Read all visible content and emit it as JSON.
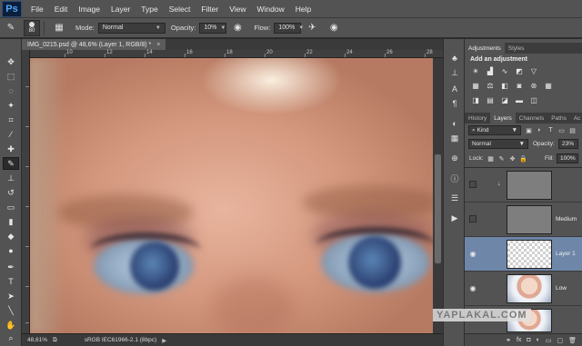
{
  "app": {
    "logo": "Ps"
  },
  "menu": [
    "File",
    "Edit",
    "Image",
    "Layer",
    "Type",
    "Select",
    "Filter",
    "View",
    "Window",
    "Help"
  ],
  "options": {
    "brush_size": "80",
    "mode_label": "Mode:",
    "mode_value": "Normal",
    "opacity_label": "Opacity:",
    "opacity_value": "10%",
    "flow_label": "Flow:",
    "flow_value": "100%"
  },
  "document": {
    "tab_title": "IMG_0215.psd @ 48,6% (Layer 1, RGB/8) *",
    "tab_close": "×",
    "ruler_numbers": [
      "10",
      "12",
      "14",
      "16",
      "18",
      "20",
      "22",
      "24",
      "26",
      "28"
    ],
    "zoom": "48,61%",
    "color_profile": "sRGB IEC61966-2.1 (8bpc)",
    "status_arrow": "▶"
  },
  "adjustments_panel": {
    "tabs": [
      "Adjustments",
      "Styles"
    ],
    "title": "Add an adjustment"
  },
  "layers_panel": {
    "tabs": [
      "History",
      "Layers",
      "Channels",
      "Paths",
      "Ac"
    ],
    "kind_filter": "Kind",
    "blend_mode": "Normal",
    "opacity_label": "Opacity:",
    "opacity_value": "23%",
    "lock_label": "Lock:",
    "fill_label": "Fill:",
    "fill_value": "100%",
    "layers": [
      {
        "name": "",
        "visible": false,
        "thumb": "gray",
        "linked": true,
        "selected": false
      },
      {
        "name": "Medium",
        "visible": false,
        "thumb": "gray",
        "linked": false,
        "selected": false
      },
      {
        "name": "Layer 1",
        "visible": true,
        "thumb": "transparent",
        "linked": false,
        "selected": true
      },
      {
        "name": "Low",
        "visible": true,
        "thumb": "photo",
        "linked": false,
        "selected": false
      },
      {
        "name": "",
        "visible": false,
        "thumb": "photo",
        "linked": false,
        "selected": false
      }
    ],
    "footer_icons": [
      "fx",
      "mask-icon",
      "adjustment-icon",
      "folder-icon",
      "new-layer-icon",
      "trash-icon"
    ]
  },
  "watermark": "YAPLAKAL.COM",
  "colors": {
    "ui_dark": "#535353",
    "selected_layer": "#6e86a8"
  }
}
